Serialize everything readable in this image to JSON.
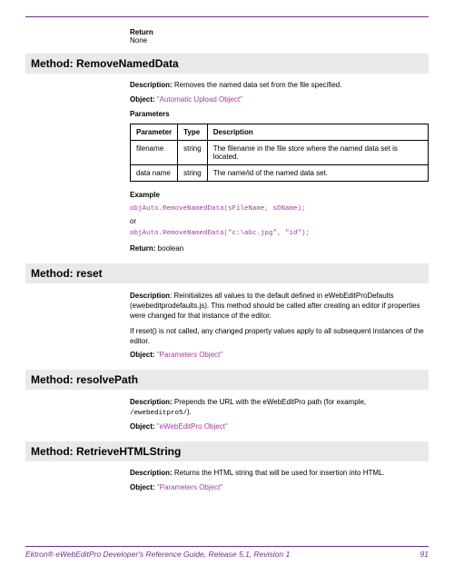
{
  "section0": {
    "return_label": "Return",
    "return_value": "None"
  },
  "method1": {
    "title": "Method: RemoveNamedData",
    "desc_label": "Description:",
    "desc_text": " Removes the named data set from the file specified.",
    "object_label": "Object:",
    "object_link": " \"Automatic Upload Object\"",
    "params_label": "Parameters",
    "table": {
      "headers": [
        "Parameter",
        "Type",
        "Description"
      ],
      "rows": [
        [
          "filename",
          "string",
          "The filename in the file store where the named data set is located."
        ],
        [
          "data name",
          "string",
          "The name/id of the named data set."
        ]
      ]
    },
    "example_label": "Example",
    "example_code1": "objAuto.RemoveNamedData(sFileName, sDName);",
    "or_text": "or",
    "example_code2": "objAuto.RemoveNamedData(\"c:\\abc.jpg\", \"id\");",
    "return_label": "Return:",
    "return_value": " boolean"
  },
  "method2": {
    "title": "Method: reset",
    "desc_label": "Description",
    "desc_text": ": Reinitializes all values to the default defined in eWebEditProDefaults (ewebeditprodefaults.js). This method should be called after creating an editor if properties were changed for that instance of the editor.",
    "desc_text2": "If reset() is not called, any changed property values apply to all subsequent instances of the editor.",
    "object_label": "Object:",
    "object_link": " \"Parameters Object\""
  },
  "method3": {
    "title": "Method: resolvePath",
    "desc_label": "Description:",
    "desc_text1": " Prepends the URL with the eWebEditPro path (for example, ",
    "desc_code": "/ewebeditpro5/",
    "desc_text2": ").",
    "object_label": "Object:",
    "object_link": " \"eWebEditPro Object\""
  },
  "method4": {
    "title": "Method: RetrieveHTMLString",
    "desc_label": "Description:",
    "desc_text": " Returns the HTML string that will be used for insertion into HTML.",
    "object_label": "Object:",
    "object_link": " \"Parameters Object\""
  },
  "footer": {
    "ref": "Ektron® eWebEditPro Developer's Reference Guide, Release 5.1, Revision 1",
    "page": "91"
  }
}
